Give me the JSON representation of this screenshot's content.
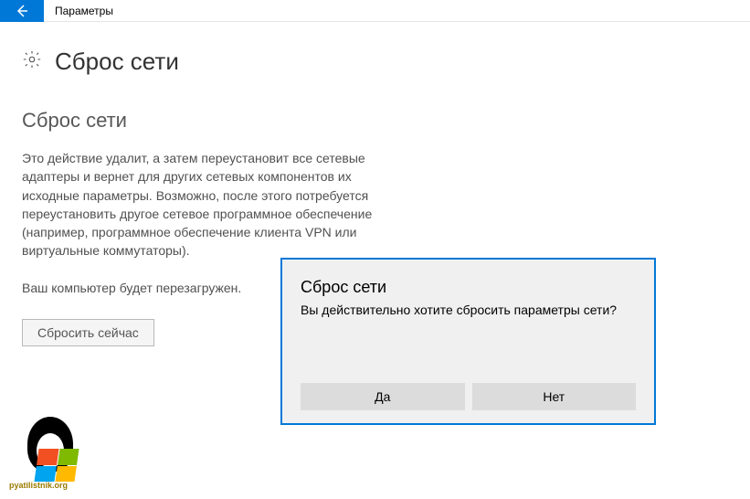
{
  "titlebar": {
    "title": "Параметры"
  },
  "page": {
    "title": "Сброс сети"
  },
  "section": {
    "title": "Сброс сети",
    "description": "Это действие удалит, а затем переустановит все сетевые адаптеры и вернет для других сетевых компонентов их исходные параметры. Возможно, после этого потребуется переустановить другое сетевое программное обеспечение (например, программное обеспечение клиента VPN или виртуальные коммутаторы).",
    "warning": "Ваш компьютер будет перезагружен.",
    "button_label": "Сбросить сейчас"
  },
  "dialog": {
    "title": "Сброс сети",
    "text": "Вы действительно хотите сбросить параметры сети?",
    "yes_label": "Да",
    "no_label": "Нет"
  },
  "watermark": {
    "text": "pyatilistnik.org"
  }
}
